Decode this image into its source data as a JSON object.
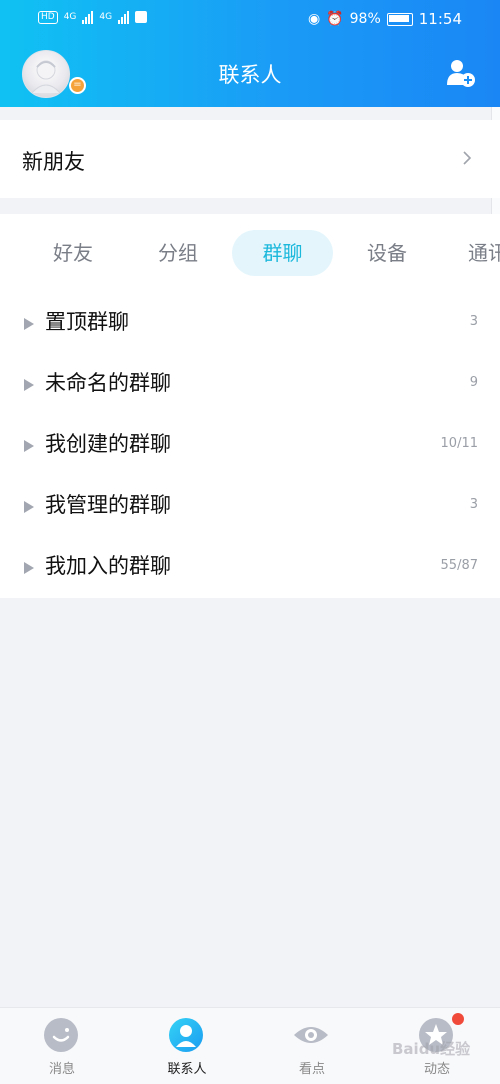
{
  "status_bar": {
    "hd": "HD",
    "net1": "4G",
    "net2": "4G",
    "battery": "98%",
    "time": "11:54"
  },
  "header": {
    "title": "联系人",
    "avatar_badge": "=",
    "icons": [
      "avatar",
      "add-contact-icon"
    ]
  },
  "new_friends": {
    "label": "新朋友"
  },
  "tabs": [
    {
      "label": "好友",
      "active": false
    },
    {
      "label": "分组",
      "active": false
    },
    {
      "label": "群聊",
      "active": true
    },
    {
      "label": "设备",
      "active": false
    },
    {
      "label": "通讯",
      "active": false
    }
  ],
  "groups": [
    {
      "name": "置顶群聊",
      "count": "3"
    },
    {
      "name": "未命名的群聊",
      "count": "9"
    },
    {
      "name": "我创建的群聊",
      "count": "10/11"
    },
    {
      "name": "我管理的群聊",
      "count": "3"
    },
    {
      "name": "我加入的群聊",
      "count": "55/87"
    }
  ],
  "bottom_nav": [
    {
      "label": "消息",
      "icon": "message-icon",
      "active": false
    },
    {
      "label": "联系人",
      "icon": "contacts-icon",
      "active": true
    },
    {
      "label": "看点",
      "icon": "eye-icon",
      "active": false
    },
    {
      "label": "动态",
      "icon": "star-icon",
      "active": false
    }
  ],
  "watermark": "Baidu经验",
  "colors": {
    "header_start": "#10c2f3",
    "header_end": "#1a86f5",
    "tab_active_text": "#1cb8dc",
    "tab_active_bg": "#e4f6fc",
    "nav_active": "#1eb6f0",
    "notification_dot": "#f04b3a"
  }
}
